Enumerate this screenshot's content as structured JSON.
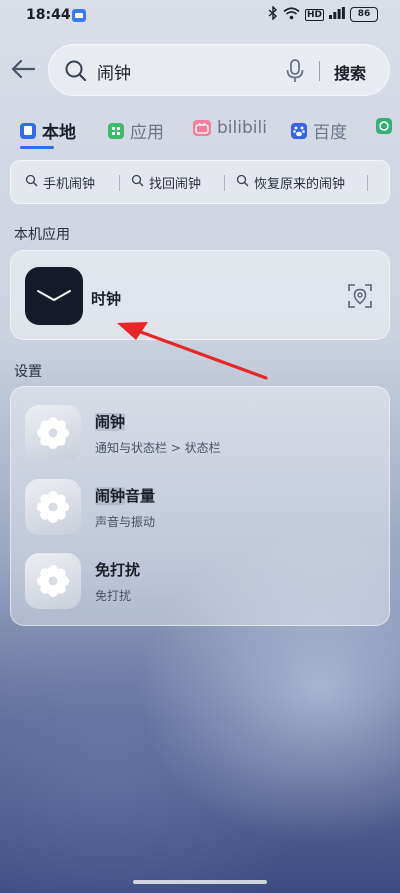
{
  "status_bar": {
    "time": "18:44",
    "hd": "HD",
    "battery": "86"
  },
  "search": {
    "query": "闹钟",
    "button_label": "搜索"
  },
  "tabs": [
    {
      "label": "本地",
      "active": true
    },
    {
      "label": "应用",
      "active": false
    },
    {
      "label": "bilibili",
      "active": false
    },
    {
      "label": "百度",
      "active": false
    }
  ],
  "suggestions": [
    "手机闹钟",
    "找回闹钟",
    "恢复原来的闹钟"
  ],
  "local_apps": {
    "section_title": "本机应用",
    "apps": [
      {
        "name": "时钟",
        "icon": "clock-icon"
      }
    ]
  },
  "settings": {
    "section_title": "设置",
    "items": [
      {
        "title_highlight": "闹钟",
        "title_rest": "",
        "subtitle": "通知与状态栏 > 状态栏",
        "icon": "gear-icon"
      },
      {
        "title_highlight": "闹钟",
        "title_rest": "音量",
        "subtitle": "声音与振动",
        "icon": "gear-icon"
      },
      {
        "title_highlight": "",
        "title_rest": "免打扰",
        "subtitle": "免打扰",
        "icon": "gear-icon"
      }
    ]
  },
  "colors": {
    "accent": "#2f6cf2",
    "annotation_arrow": "#e8262a"
  }
}
